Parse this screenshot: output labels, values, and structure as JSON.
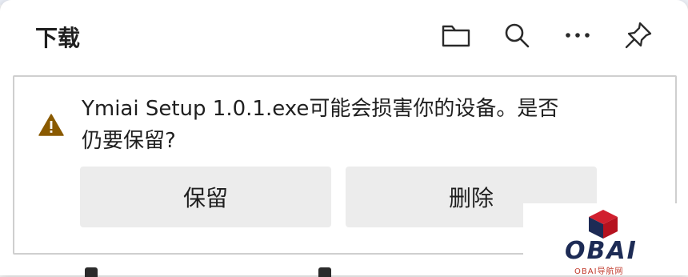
{
  "header": {
    "title": "下载",
    "icons": [
      "folder-icon",
      "search-icon",
      "more-icon",
      "pin-icon"
    ]
  },
  "warning": {
    "icon": "warning-icon",
    "message": "Ymiai Setup 1.0.1.exe可能会损害你的设备。是否仍要保留?",
    "keep_label": "保留",
    "delete_label": "删除"
  },
  "watermark": {
    "text": "OBAI",
    "subtext": "OBAI导航网",
    "colors": {
      "red": "#c0392b",
      "navy": "#1d2b55"
    }
  }
}
